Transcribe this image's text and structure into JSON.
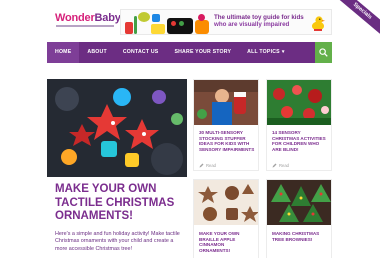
{
  "header": {
    "logo_part1": "Wonder",
    "logo_part2": "Baby",
    "logo_reg": "®",
    "banner_line1": "The ultimate toy guide for kids",
    "banner_line2": "who are visually impaired",
    "ribbon_label": "Specials"
  },
  "nav": {
    "items": [
      {
        "label": "HOME",
        "active": true
      },
      {
        "label": "ABOUT",
        "active": false
      },
      {
        "label": "CONTACT US",
        "active": false
      },
      {
        "label": "SHARE YOUR STORY",
        "active": false
      },
      {
        "label": "ALL TOPICS",
        "active": false
      }
    ],
    "caret": "▾",
    "search_icon": "search-icon"
  },
  "hero": {
    "title": "MAKE YOUR OWN TACTILE CHRISTMAS ORNAMENTS!",
    "description": "Here's a simple and fun holiday activity! Make tactile Christmas ornaments with your child and create a more accessible Christmas tree!"
  },
  "cards": [
    {
      "title": "30 MULTI-SENSORY STOCKING STUFFER IDEAS FOR KIDS WITH SENSORY IMPAIRMENTS",
      "meta": "Read"
    },
    {
      "title": "14 SENSORY CHRISTMAS ACTIVITIES FOR CHILDREN WHO ARE BLIND!",
      "meta": "Read"
    },
    {
      "title": "MAKE YOUR OWN BRAILLE APPLE CINNAMON ORNAMENTS!",
      "meta": ""
    },
    {
      "title": "MAKING CHRISTMAS TREE BROWNIES!",
      "meta": ""
    }
  ],
  "colors": {
    "brand_purple": "#7b2d8e",
    "nav_bg": "#6c2d83",
    "search_green": "#63b04a",
    "logo_pink": "#d6227b"
  }
}
